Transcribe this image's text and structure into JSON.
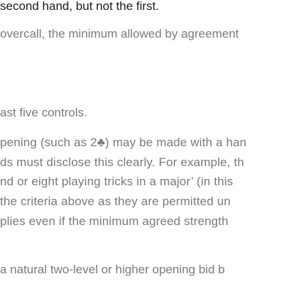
{
  "document": {
    "lines": [
      "second hand, but not the first.",
      "overcall, the minimum allowed by agreement",
      "ast five controls.",
      "pening (such as 2♣) may be made with a han",
      "ds must disclose this clearly. For example, th",
      "nd or eight playing tricks in a major’ (in this",
      "the criteria above as they are permitted un",
      "plies even if the minimum agreed strength",
      "a natural two-level or higher opening bid b"
    ]
  }
}
